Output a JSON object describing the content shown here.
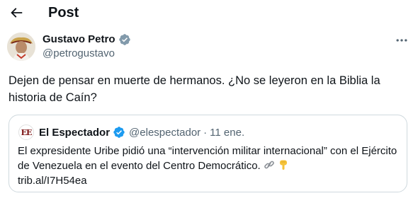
{
  "header": {
    "title": "Post",
    "back_icon": "back-arrow-icon"
  },
  "author": {
    "name": "Gustavo Petro",
    "handle": "@petrogustavo",
    "verified_color": "#1d9bf0"
  },
  "tweet": {
    "text": "Dejen de pensar en muerte de hermanos. ¿No se leyeron en la Biblia la historia de Caín?"
  },
  "quote": {
    "avatar_text": "EE",
    "name": "El Espectador",
    "handle": "@elespectador",
    "separator": "·",
    "date": "11 ene.",
    "text": "El expresidente Uribe pidió una “intervención militar internacional” con el Ejército de Venezuela en el evento del Centro Democrático.",
    "link": "trib.al/I7H54ea"
  },
  "colors": {
    "text_primary": "#0f1419",
    "text_secondary": "#536471",
    "border": "#cfd9de",
    "accent": "#1d9bf0"
  }
}
